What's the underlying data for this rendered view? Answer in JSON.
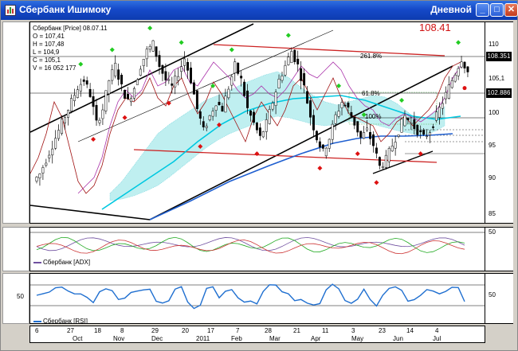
{
  "window": {
    "title": "Сбербанк Ишимоку",
    "period": "Дневной",
    "buttons": {
      "minimize": "_",
      "maximize": "□",
      "close": "✕"
    }
  },
  "colors": {
    "titlebar": "#1549c8",
    "up_arrow": "#22cc22",
    "down_arrow": "#dd1111",
    "cloud_fill": "#bfeff0",
    "kijun": "#a01010",
    "tenkan": "#aa33aa",
    "sma_cyan": "#00c8e0",
    "sma_blue": "#1f5fd0",
    "adx_line": "#7050a0",
    "rsi_line": "#1f6fd0"
  },
  "price_panel": {
    "info": {
      "header": "Сбербанк [Price] 08.07.11",
      "open": "O = 107,41",
      "high": "H = 107,48",
      "low": "L = 104,9",
      "close": "C = 105,1",
      "volume": "V = 16 052 177"
    },
    "big_price_label": "108.41",
    "fib_labels": {
      "f261": "261.8%",
      "f61": "61.8%",
      "f100": "100%"
    },
    "y_ticks": [
      "110",
      "105",
      "100",
      "95",
      "90",
      "85"
    ],
    "right_labels": [
      "105,1"
    ],
    "price_boxes": {
      "resistance": "108.351",
      "support": "102.886"
    }
  },
  "adx_panel": {
    "label": "Сбербанк [ADX]",
    "y_ticks": [
      "50"
    ],
    "left_ticks": [
      "50"
    ]
  },
  "rsi_panel": {
    "label": "Сбербанк [RSI]",
    "y_ticks": [
      "50"
    ],
    "left_ticks": [
      "50"
    ]
  },
  "x_axis": {
    "days": [
      "6",
      "27",
      "18",
      "8",
      "29",
      "20",
      "17",
      "7",
      "28",
      "21",
      "11",
      "3",
      "23",
      "14",
      "4"
    ],
    "months": [
      "Oct",
      "Nov",
      "Dec",
      "2011",
      "Feb",
      "Mar",
      "Apr",
      "May",
      "Jun",
      "Jul"
    ]
  },
  "chart_data": {
    "type": "line",
    "title": "",
    "ylim": [
      84,
      112
    ],
    "y_ticks": [
      85,
      90,
      95,
      100,
      105,
      110
    ],
    "grid": false,
    "x_labels": [
      "Oct",
      "Nov",
      "Dec",
      "2011",
      "Feb",
      "Mar",
      "Apr",
      "May",
      "Jun",
      "Jul"
    ],
    "series": [
      {
        "values": [
          91,
          93,
          95,
          97,
          99,
          101,
          103,
          104,
          102,
          98,
          100,
          104,
          106,
          103,
          101,
          103,
          106,
          108,
          109,
          106,
          104,
          103,
          105,
          107,
          104,
          100,
          97,
          99,
          101,
          100,
          103,
          106,
          104,
          100,
          98,
          96,
          98,
          101,
          104,
          106,
          108,
          106,
          103,
          99,
          96,
          94,
          96,
          99,
          101,
          100,
          98,
          96,
          97,
          95,
          92,
          93,
          95,
          97,
          99,
          98,
          97,
          96,
          97,
          99,
          101,
          103,
          105,
          107,
          105.1
        ]
      }
    ],
    "levels": {
      "resistance": 108.351,
      "support": 102.886
    }
  }
}
